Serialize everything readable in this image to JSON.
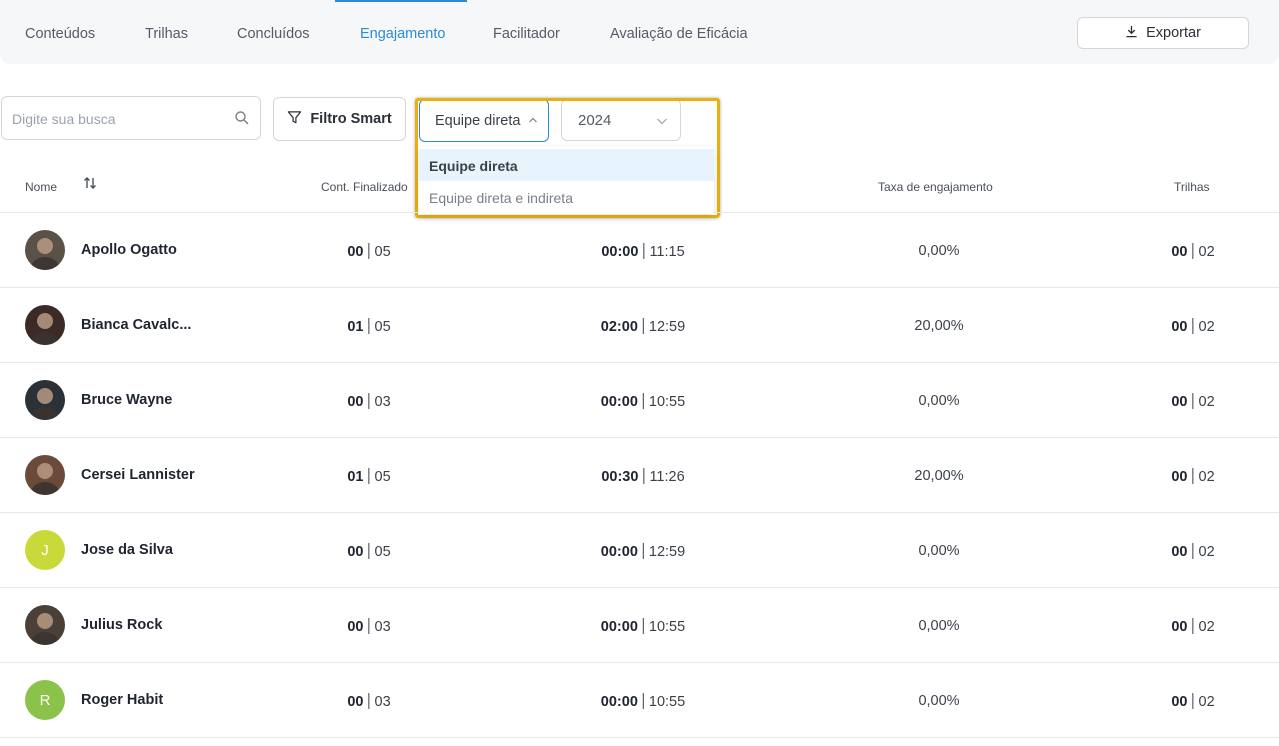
{
  "tabs": [
    {
      "label": "Conteúdos",
      "active": false
    },
    {
      "label": "Trilhas",
      "active": false
    },
    {
      "label": "Concluídos",
      "active": false
    },
    {
      "label": "Engajamento",
      "active": true
    },
    {
      "label": "Facilitador",
      "active": false
    },
    {
      "label": "Avaliação de Eficácia",
      "active": false
    }
  ],
  "export_label": "Exportar",
  "search": {
    "placeholder": "Digite sua busca"
  },
  "smart_filter_label": "Filtro Smart",
  "team_select": {
    "value": "Equipe direta",
    "open": true,
    "options": [
      "Equipe direta",
      "Equipe direta e indireta"
    ]
  },
  "year_select": {
    "value": "2024"
  },
  "columns": {
    "name": "Nome",
    "content_finished": "Cont. Finalizado",
    "engagement_rate": "Taxa de engajamento",
    "trails": "Trilhas"
  },
  "rows": [
    {
      "name": "Apollo Ogatto",
      "avatar": "photo",
      "cont_done": "00",
      "cont_total": "05",
      "time_done": "00:00",
      "time_total": "11:15",
      "rate": "0,00%",
      "trails_done": "00",
      "trails_total": "02"
    },
    {
      "name": "Bianca Cavalc...",
      "avatar": "photo",
      "cont_done": "01",
      "cont_total": "05",
      "time_done": "02:00",
      "time_total": "12:59",
      "rate": "20,00%",
      "trails_done": "00",
      "trails_total": "02"
    },
    {
      "name": "Bruce Wayne",
      "avatar": "photo",
      "cont_done": "00",
      "cont_total": "03",
      "time_done": "00:00",
      "time_total": "10:55",
      "rate": "0,00%",
      "trails_done": "00",
      "trails_total": "02"
    },
    {
      "name": "Cersei Lannister",
      "avatar": "photo",
      "cont_done": "01",
      "cont_total": "05",
      "time_done": "00:30",
      "time_total": "11:26",
      "rate": "20,00%",
      "trails_done": "00",
      "trails_total": "02"
    },
    {
      "name": "Jose da Silva",
      "avatar": "J",
      "avatar_color": "#c9d93a",
      "cont_done": "00",
      "cont_total": "05",
      "time_done": "00:00",
      "time_total": "12:59",
      "rate": "0,00%",
      "trails_done": "00",
      "trails_total": "02"
    },
    {
      "name": "Julius Rock",
      "avatar": "photo",
      "cont_done": "00",
      "cont_total": "03",
      "time_done": "00:00",
      "time_total": "10:55",
      "rate": "0,00%",
      "trails_done": "00",
      "trails_total": "02"
    },
    {
      "name": "Roger Habit",
      "avatar": "R",
      "avatar_color": "#8bc34a",
      "cont_done": "00",
      "cont_total": "03",
      "time_done": "00:00",
      "time_total": "10:55",
      "rate": "0,00%",
      "trails_done": "00",
      "trails_total": "02"
    }
  ],
  "colors": {
    "accent": "#2a8bd6",
    "highlight": "#e8b10d"
  }
}
